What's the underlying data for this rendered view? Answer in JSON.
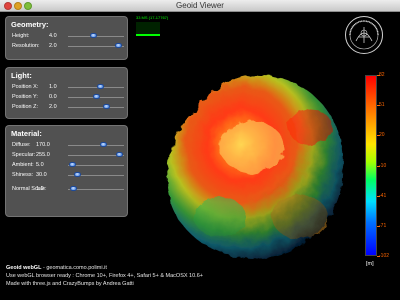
{
  "window": {
    "title": "Geoid Viewer"
  },
  "stats": {
    "text": "33 MS (17-17767)"
  },
  "geometry": {
    "title": "Geometry:",
    "rows": [
      {
        "label": "Height:",
        "value": "4.0",
        "position": 0.45
      },
      {
        "label": "Resolution:",
        "value": "2.0",
        "position": 0.95
      }
    ]
  },
  "light": {
    "title": "Light:",
    "rows": [
      {
        "label": "Position X:",
        "value": "1.0",
        "position": 0.6
      },
      {
        "label": "Position Y:",
        "value": "0.0",
        "position": 0.5
      },
      {
        "label": "Position Z:",
        "value": "2.0",
        "position": 0.72
      }
    ]
  },
  "material": {
    "title": "Material:",
    "rows": [
      {
        "label": "Diffuse:",
        "value": "170.0",
        "position": 0.66
      },
      {
        "label": "Specular:",
        "value": "255.0",
        "position": 0.97
      },
      {
        "label": "Ambient:",
        "value": "5.0",
        "position": 0.02
      },
      {
        "label": "Shiness:",
        "value": "30.0",
        "position": 0.12
      },
      {
        "label": "Normal Scale:",
        "value": "1.0",
        "position": 0.05
      }
    ]
  },
  "color_scale": {
    "ticks": [
      "82",
      "51",
      "20",
      "-10",
      "-41",
      "-71",
      "-102"
    ],
    "unit": "[m]"
  },
  "footer": {
    "title": "Geoid webGL",
    "site": " - geomatica.como.polimi.it",
    "line2": "Use webGL browser ready : Chrome 10+, Firefox 4+, Safari 5+ & MacOSX 10.6+",
    "line3": "Made with three.js and CrazyBumps by Andrea Gatti"
  },
  "colors": {
    "panel": "#585858",
    "slider_knob": "#2b6fd6",
    "tick_text": "#ff6600",
    "stats": "#00ff00"
  }
}
